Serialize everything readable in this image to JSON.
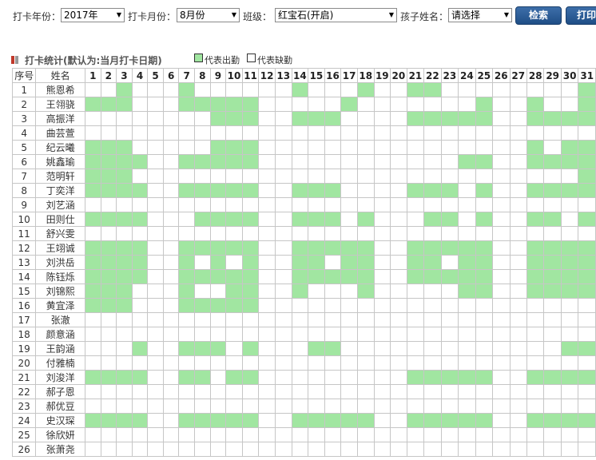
{
  "filters": {
    "year": {
      "label": "打卡年份：",
      "value": "2017年"
    },
    "month": {
      "label": "打卡月份：",
      "value": "8月份"
    },
    "class": {
      "label": "班级：",
      "value": "红宝石(开启)"
    },
    "child": {
      "label": "孩子姓名：",
      "value": "请选择"
    }
  },
  "buttons": {
    "search": "检索",
    "print": "打印"
  },
  "stats": {
    "title": "打卡统计(默认为:当月打卡日期)",
    "legend_present": "代表出勤",
    "legend_absent": "代表缺勤"
  },
  "colors": {
    "present": "#a1e6a1",
    "absent": "#ffffff",
    "button": "#2a5b95",
    "marker_red": "#c0392b",
    "marker_gray": "#999999"
  },
  "table": {
    "headers": {
      "no": "序号",
      "name": "姓名"
    },
    "days": [
      "1",
      "2",
      "3",
      "4",
      "5",
      "6",
      "7",
      "8",
      "9",
      "10",
      "11",
      "12",
      "13",
      "14",
      "15",
      "16",
      "17",
      "18",
      "19",
      "20",
      "21",
      "22",
      "23",
      "24",
      "25",
      "26",
      "27",
      "28",
      "29",
      "30",
      "31"
    ],
    "rows": [
      {
        "no": "1",
        "name": "熊恩希",
        "attendance": [
          0,
          0,
          1,
          0,
          0,
          0,
          1,
          0,
          0,
          0,
          0,
          0,
          0,
          1,
          0,
          0,
          0,
          1,
          0,
          0,
          1,
          1,
          0,
          0,
          0,
          0,
          0,
          0,
          0,
          0,
          1
        ]
      },
      {
        "no": "2",
        "name": "王翎骁",
        "attendance": [
          1,
          1,
          1,
          0,
          0,
          0,
          1,
          1,
          1,
          1,
          1,
          0,
          0,
          0,
          0,
          0,
          1,
          0,
          0,
          0,
          0,
          0,
          0,
          0,
          1,
          0,
          0,
          1,
          0,
          0,
          1
        ]
      },
      {
        "no": "3",
        "name": "高振洋",
        "attendance": [
          0,
          0,
          0,
          0,
          0,
          0,
          0,
          0,
          1,
          1,
          1,
          0,
          0,
          1,
          1,
          1,
          0,
          0,
          0,
          0,
          1,
          1,
          1,
          1,
          1,
          0,
          0,
          1,
          1,
          1,
          1
        ]
      },
      {
        "no": "4",
        "name": "曲芸萱",
        "attendance": [
          0,
          0,
          0,
          0,
          0,
          0,
          0,
          0,
          0,
          0,
          0,
          0,
          0,
          0,
          0,
          0,
          0,
          0,
          0,
          0,
          0,
          0,
          0,
          0,
          0,
          0,
          0,
          0,
          0,
          0,
          0
        ]
      },
      {
        "no": "5",
        "name": "纪云曦",
        "attendance": [
          1,
          1,
          1,
          0,
          0,
          0,
          0,
          0,
          1,
          1,
          1,
          0,
          0,
          0,
          0,
          0,
          0,
          0,
          0,
          0,
          0,
          0,
          0,
          0,
          0,
          0,
          0,
          1,
          0,
          1,
          1
        ]
      },
      {
        "no": "6",
        "name": "姚鑫瑜",
        "attendance": [
          1,
          1,
          1,
          1,
          0,
          0,
          1,
          1,
          1,
          1,
          1,
          0,
          0,
          0,
          0,
          0,
          0,
          0,
          0,
          0,
          0,
          0,
          0,
          1,
          1,
          0,
          0,
          1,
          1,
          1,
          1
        ]
      },
      {
        "no": "7",
        "name": "范明轩",
        "attendance": [
          1,
          1,
          1,
          0,
          0,
          0,
          0,
          0,
          0,
          0,
          0,
          0,
          0,
          0,
          0,
          0,
          0,
          0,
          0,
          0,
          0,
          0,
          0,
          0,
          0,
          0,
          0,
          0,
          0,
          0,
          1
        ]
      },
      {
        "no": "8",
        "name": "丁奕洋",
        "attendance": [
          1,
          1,
          1,
          1,
          0,
          0,
          1,
          1,
          1,
          1,
          1,
          0,
          0,
          1,
          1,
          1,
          0,
          0,
          0,
          0,
          1,
          1,
          1,
          0,
          1,
          0,
          0,
          1,
          1,
          1,
          1
        ]
      },
      {
        "no": "9",
        "name": "刘艺涵",
        "attendance": [
          0,
          0,
          0,
          0,
          0,
          0,
          0,
          0,
          0,
          0,
          0,
          0,
          0,
          0,
          0,
          0,
          0,
          0,
          0,
          0,
          0,
          0,
          0,
          0,
          0,
          0,
          0,
          0,
          0,
          0,
          0
        ]
      },
      {
        "no": "10",
        "name": "田则仕",
        "attendance": [
          1,
          1,
          1,
          1,
          0,
          0,
          0,
          1,
          1,
          1,
          1,
          0,
          0,
          1,
          1,
          1,
          0,
          1,
          0,
          0,
          0,
          1,
          1,
          0,
          1,
          0,
          0,
          1,
          1,
          0,
          1
        ]
      },
      {
        "no": "11",
        "name": "舒兴雯",
        "attendance": [
          0,
          0,
          0,
          0,
          0,
          0,
          0,
          0,
          0,
          0,
          0,
          0,
          0,
          0,
          0,
          0,
          0,
          0,
          0,
          0,
          0,
          0,
          0,
          0,
          0,
          0,
          0,
          0,
          0,
          0,
          0
        ]
      },
      {
        "no": "12",
        "name": "王翊诚",
        "attendance": [
          1,
          1,
          1,
          1,
          0,
          0,
          1,
          1,
          1,
          1,
          1,
          0,
          0,
          1,
          1,
          1,
          1,
          1,
          0,
          0,
          1,
          1,
          1,
          1,
          1,
          0,
          0,
          1,
          1,
          1,
          1
        ]
      },
      {
        "no": "13",
        "name": "刘洪岳",
        "attendance": [
          1,
          1,
          1,
          1,
          0,
          0,
          1,
          0,
          1,
          0,
          1,
          0,
          0,
          1,
          1,
          0,
          1,
          1,
          0,
          0,
          1,
          1,
          0,
          1,
          1,
          0,
          0,
          1,
          1,
          1,
          1
        ]
      },
      {
        "no": "14",
        "name": "陈钰烁",
        "attendance": [
          1,
          1,
          1,
          1,
          0,
          0,
          1,
          1,
          1,
          1,
          1,
          0,
          0,
          1,
          1,
          1,
          1,
          1,
          0,
          0,
          1,
          1,
          1,
          1,
          1,
          0,
          0,
          1,
          1,
          1,
          1
        ]
      },
      {
        "no": "15",
        "name": "刘锦熙",
        "attendance": [
          1,
          1,
          1,
          0,
          0,
          0,
          1,
          0,
          0,
          1,
          1,
          0,
          0,
          1,
          0,
          0,
          0,
          1,
          0,
          0,
          0,
          0,
          0,
          1,
          1,
          0,
          0,
          1,
          1,
          1,
          1
        ]
      },
      {
        "no": "16",
        "name": "黄宜泽",
        "attendance": [
          1,
          1,
          1,
          0,
          0,
          0,
          1,
          1,
          1,
          1,
          1,
          0,
          0,
          0,
          0,
          0,
          0,
          0,
          0,
          0,
          0,
          0,
          0,
          0,
          0,
          0,
          0,
          0,
          0,
          0,
          0
        ]
      },
      {
        "no": "17",
        "name": "张澈",
        "attendance": [
          0,
          0,
          0,
          0,
          0,
          0,
          0,
          0,
          0,
          0,
          0,
          0,
          0,
          0,
          0,
          0,
          0,
          0,
          0,
          0,
          0,
          0,
          0,
          0,
          0,
          0,
          0,
          0,
          0,
          0,
          0
        ]
      },
      {
        "no": "18",
        "name": "颜意涵",
        "attendance": [
          0,
          0,
          0,
          0,
          0,
          0,
          0,
          0,
          0,
          0,
          0,
          0,
          0,
          0,
          0,
          0,
          0,
          0,
          0,
          0,
          0,
          0,
          0,
          0,
          0,
          0,
          0,
          0,
          0,
          0,
          0
        ]
      },
      {
        "no": "19",
        "name": "王韵涵",
        "attendance": [
          0,
          0,
          0,
          1,
          0,
          0,
          1,
          1,
          1,
          0,
          1,
          0,
          0,
          0,
          1,
          1,
          0,
          0,
          0,
          0,
          0,
          0,
          0,
          0,
          0,
          0,
          0,
          0,
          0,
          1,
          1
        ]
      },
      {
        "no": "20",
        "name": "付雅楠",
        "attendance": [
          0,
          0,
          0,
          0,
          0,
          0,
          0,
          0,
          0,
          0,
          0,
          0,
          0,
          0,
          0,
          0,
          0,
          0,
          0,
          0,
          0,
          0,
          0,
          0,
          0,
          0,
          0,
          0,
          0,
          0,
          0
        ]
      },
      {
        "no": "21",
        "name": "刘浚洋",
        "attendance": [
          1,
          1,
          1,
          1,
          0,
          0,
          1,
          1,
          0,
          1,
          1,
          0,
          0,
          0,
          0,
          0,
          0,
          0,
          0,
          0,
          1,
          1,
          1,
          1,
          1,
          0,
          0,
          1,
          1,
          1,
          1
        ]
      },
      {
        "no": "22",
        "name": "郝子恩",
        "attendance": [
          0,
          0,
          0,
          0,
          0,
          0,
          0,
          0,
          0,
          0,
          0,
          0,
          0,
          0,
          0,
          0,
          0,
          0,
          0,
          0,
          0,
          0,
          0,
          0,
          0,
          0,
          0,
          0,
          0,
          0,
          0
        ]
      },
      {
        "no": "23",
        "name": "郝优豆",
        "attendance": [
          0,
          0,
          0,
          0,
          0,
          0,
          0,
          0,
          0,
          0,
          0,
          0,
          0,
          0,
          0,
          0,
          0,
          0,
          0,
          0,
          0,
          0,
          0,
          0,
          0,
          0,
          0,
          0,
          0,
          0,
          0
        ]
      },
      {
        "no": "24",
        "name": "史汉琛",
        "attendance": [
          1,
          1,
          1,
          1,
          0,
          0,
          1,
          1,
          1,
          1,
          1,
          0,
          0,
          1,
          1,
          1,
          1,
          1,
          0,
          0,
          1,
          1,
          1,
          1,
          1,
          0,
          0,
          1,
          1,
          1,
          1
        ]
      },
      {
        "no": "25",
        "name": "徐欣妍",
        "attendance": [
          0,
          0,
          0,
          0,
          0,
          0,
          0,
          0,
          0,
          0,
          0,
          0,
          0,
          0,
          0,
          0,
          0,
          0,
          0,
          0,
          0,
          0,
          0,
          0,
          0,
          0,
          0,
          0,
          0,
          0,
          0
        ]
      },
      {
        "no": "26",
        "name": "张萧尧",
        "attendance": [
          0,
          0,
          0,
          0,
          0,
          0,
          0,
          0,
          0,
          0,
          0,
          0,
          0,
          0,
          0,
          0,
          0,
          0,
          0,
          0,
          0,
          0,
          0,
          0,
          0,
          0,
          0,
          0,
          0,
          0,
          0
        ]
      }
    ]
  }
}
